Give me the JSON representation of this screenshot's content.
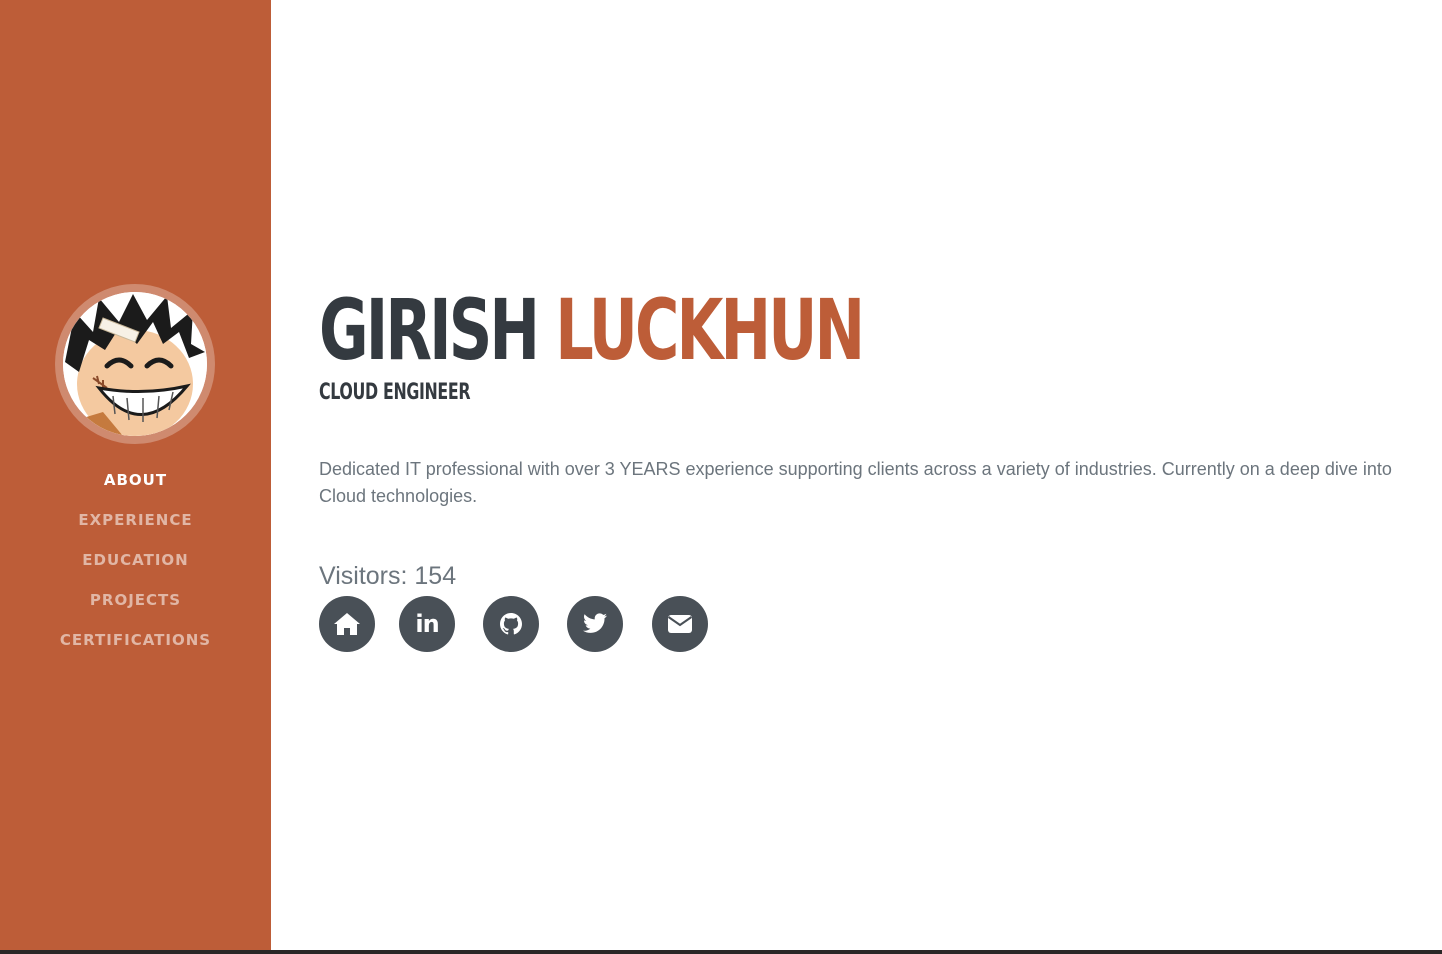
{
  "sidebar": {
    "nav": [
      {
        "label": "About",
        "active": true
      },
      {
        "label": "Experience",
        "active": false
      },
      {
        "label": "Education",
        "active": false
      },
      {
        "label": "Projects",
        "active": false
      },
      {
        "label": "Certifications",
        "active": false
      }
    ]
  },
  "profile": {
    "first_name": "GIRISH",
    "last_name": "LUCKHUN",
    "role": "CLOUD ENGINEER",
    "bio": "Dedicated IT professional with over 3 YEARS experience supporting clients across a variety of industries. Currently on a deep dive into Cloud technologies.",
    "visitors": "Visitors: 154"
  },
  "social": [
    {
      "icon": "home-icon"
    },
    {
      "icon": "linkedin-icon",
      "glyph": "in"
    },
    {
      "icon": "github-icon"
    },
    {
      "icon": "twitter-icon"
    },
    {
      "icon": "envelope-icon"
    }
  ],
  "colors": {
    "primary": "#bd5d38",
    "dark": "#343a40",
    "text_muted": "#6c757d",
    "icon_bg": "#495057"
  }
}
